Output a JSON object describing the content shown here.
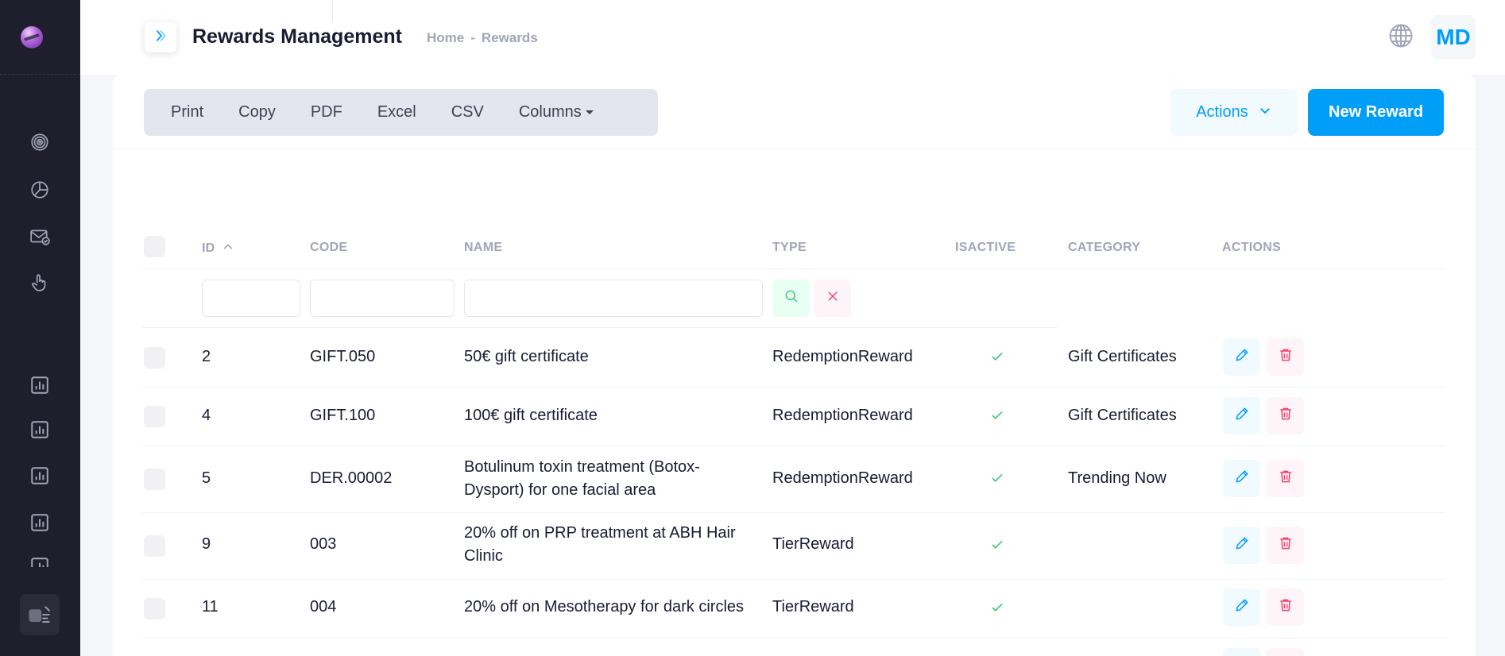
{
  "header": {
    "title": "Rewards Management",
    "breadcrumb": [
      "Home",
      "Rewards"
    ],
    "user_initials": "MD"
  },
  "toolbar": {
    "export_buttons": [
      "Print",
      "Copy",
      "PDF",
      "Excel",
      "CSV",
      "Columns"
    ],
    "actions_label": "Actions",
    "new_label": "New Reward"
  },
  "table": {
    "columns": [
      "ID",
      "CODE",
      "NAME",
      "TYPE",
      "ISACTIVE",
      "CATEGORY",
      "ACTIONS"
    ],
    "sort": {
      "column": "ID",
      "direction": "ascending"
    },
    "rows": [
      {
        "id": "2",
        "code": "GIFT.050",
        "name": [
          "50€ gift certificate"
        ],
        "type": "RedemptionReward",
        "active": true,
        "category": "Gift Certificates"
      },
      {
        "id": "4",
        "code": "GIFT.100",
        "name": [
          "100€ gift certificate"
        ],
        "type": "RedemptionReward",
        "active": true,
        "category": "Gift Certificates"
      },
      {
        "id": "5",
        "code": "DER.00002",
        "name": [
          "Botulinum toxin treatment (Botox-",
          "Dysport) for one facial area"
        ],
        "type": "RedemptionReward",
        "active": true,
        "category": "Trending Now"
      },
      {
        "id": "9",
        "code": "003",
        "name": [
          "20% off on PRP treatment at ABH Hair",
          "Clinic"
        ],
        "type": "TierReward",
        "active": true,
        "category": ""
      },
      {
        "id": "11",
        "code": "004",
        "name": [
          "20% off on Mesotherapy for dark circles"
        ],
        "type": "TierReward",
        "active": true,
        "category": ""
      }
    ]
  },
  "icons": {
    "sidebar": [
      "target-icon",
      "pie-chart-icon",
      "mail-check-icon",
      "hand-pointer-icon",
      "bar-chart-icon",
      "bar-chart-icon",
      "bar-chart-icon",
      "bar-chart-icon"
    ],
    "header": [
      "chevron-right-icon",
      "globe-icon"
    ]
  },
  "colors": {
    "primary": "#009ef7",
    "sidebar_bg": "#1e1e2d",
    "success": "#50cd89",
    "danger": "#f1416c"
  }
}
